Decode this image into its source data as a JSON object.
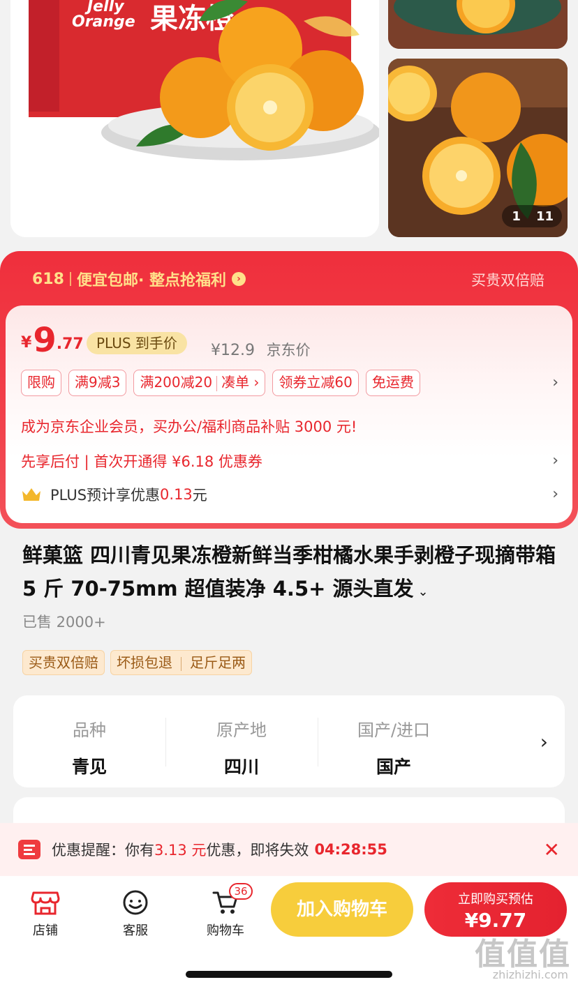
{
  "gallery": {
    "main_logo_text": "Jelly Orange 果冻橙",
    "counter_current": "1",
    "counter_total": "11"
  },
  "promo": {
    "tag_618": "618",
    "free_ship": "便宜包邮",
    "hourly": "· 整点抢福利",
    "guarantee": "买贵双倍赔"
  },
  "price": {
    "currency": "¥",
    "integer": "9",
    "decimal": ".77",
    "plus_label": "PLUS 到手价",
    "original": "¥12.9",
    "original_label": "京东价"
  },
  "tags": [
    "限购",
    "满9减3",
    "满200减20",
    "凑单 ›",
    "领券立减60",
    "免运费"
  ],
  "enterprise_line": "成为京东企业会员，买办公/福利商品补贴 3000 元!",
  "paylater_line": "先享后付 | 首次开通得 ¥6.18 优惠券",
  "plus_line": {
    "prefix": "PLUS预计享优惠",
    "amount": "0.13",
    "suffix": "元"
  },
  "product": {
    "title": "鲜菓篮 四川青见果冻橙新鲜当季柑橘水果手剥橙子现摘带箱 5 斤 70-75mm 超值装净 4.5+ 源头直发",
    "sold": "已售 2000+"
  },
  "service_tags": [
    "买贵双倍赔",
    "坏损包退",
    "足斤足两"
  ],
  "attributes": [
    {
      "key": "品种",
      "value": "青见"
    },
    {
      "key": "原产地",
      "value": "四川"
    },
    {
      "key": "国产/进口",
      "value": "国产"
    }
  ],
  "reminder": {
    "prefix": "优惠提醒：你有",
    "amount": "3.13 元",
    "suffix": "优惠，即将失效",
    "timer": "04:28:55"
  },
  "bottom_nav": {
    "shop": "店铺",
    "service": "客服",
    "cart": "购物车",
    "cart_count": "36",
    "add_cart": "加入购物车",
    "buy_line1": "立即购买预估",
    "buy_line2": "¥9.77"
  },
  "watermark": {
    "main": "值值值",
    "site": "zhizhizhi.com"
  },
  "colors": {
    "brand_red": "#e8262d",
    "plus_gold": "#f9e3a4",
    "cart_yellow": "#f7cd3c"
  }
}
